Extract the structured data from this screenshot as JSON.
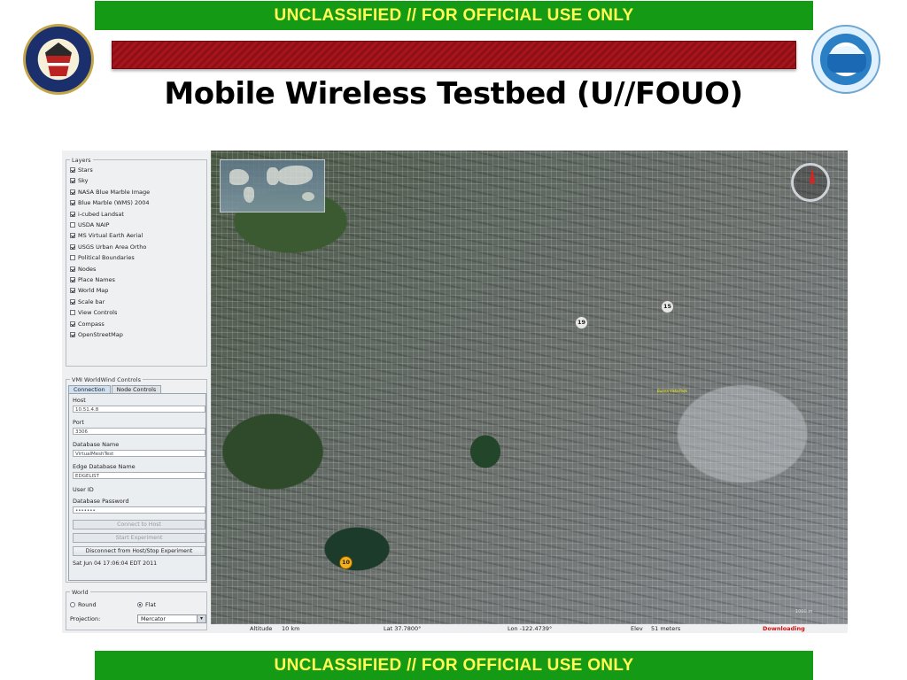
{
  "banner": {
    "top": "UNCLASSIFIED // FOR OFFICIAL USE ONLY",
    "bottom": "UNCLASSIFIED // FOR OFFICIAL USE ONLY"
  },
  "slide_title": "Mobile Wireless Testbed (U//FOUO)",
  "seals": {
    "left_icon": "nsa-seal-icon",
    "right_icon": "research-directorate-seal-icon"
  },
  "colors": {
    "banner_bg": "#159a15",
    "banner_text": "#ffff55",
    "accent_bar": "#a8141c",
    "downloading": "#d01212"
  },
  "layers": {
    "title": "Layers",
    "items": [
      {
        "label": "Stars",
        "checked": true
      },
      {
        "label": "Sky",
        "checked": true
      },
      {
        "label": "NASA Blue Marble Image",
        "checked": true
      },
      {
        "label": "Blue Marble (WMS) 2004",
        "checked": true
      },
      {
        "label": "i-cubed Landsat",
        "checked": true
      },
      {
        "label": "USDA NAIP",
        "checked": false
      },
      {
        "label": "MS Virtual Earth Aerial",
        "checked": true
      },
      {
        "label": "USGS Urban Area Ortho",
        "checked": true
      },
      {
        "label": "Political Boundaries",
        "checked": false
      },
      {
        "label": "Nodes",
        "checked": true
      },
      {
        "label": "Place Names",
        "checked": true
      },
      {
        "label": "World Map",
        "checked": true
      },
      {
        "label": "Scale bar",
        "checked": true
      },
      {
        "label": "View Controls",
        "checked": false
      },
      {
        "label": "Compass",
        "checked": true
      },
      {
        "label": "OpenStreetMap",
        "checked": true
      }
    ]
  },
  "controls": {
    "title": "VMI WorldWind Controls",
    "tabs": [
      {
        "label": "Connection",
        "active": true
      },
      {
        "label": "Node Controls",
        "active": false
      }
    ],
    "fields": [
      {
        "label": "Host",
        "value": "10.51.4.8"
      },
      {
        "label": "Port",
        "value": "3306"
      },
      {
        "label": "Database Name",
        "value": "VirtualMeshTest"
      },
      {
        "label": "Edge Database Name",
        "value": "EDGELIST"
      },
      {
        "label": "User ID",
        "value": ""
      },
      {
        "label": "Database Password",
        "value": "•••••••"
      }
    ],
    "buttons": {
      "connect": "Connect to Host",
      "start": "Start Experiment",
      "disconnect": "Disconnect from Host/Stop Experiment"
    },
    "timestamp": "Sat Jun 04 17:06:04 EDT 2011"
  },
  "world": {
    "title": "World",
    "round_label": "Round",
    "flat_label": "Flat",
    "selected": "Flat",
    "projection_label": "Projection:",
    "projection_value": "Mercator"
  },
  "map": {
    "nodes": [
      {
        "id": "19",
        "highlighted": false
      },
      {
        "id": "15",
        "highlighted": false
      },
      {
        "id": "10",
        "highlighted": true
      }
    ],
    "place_label": "Buena Vista Park",
    "scale_text": "1000 m"
  },
  "status": {
    "altitude_label": "Altitude",
    "altitude_value": "10 km",
    "lat": "Lat 37.7800°",
    "lon": "Lon -122.4739°",
    "elev_label": "Elev",
    "elev_value": "51 meters",
    "downloading": "Downloading"
  }
}
